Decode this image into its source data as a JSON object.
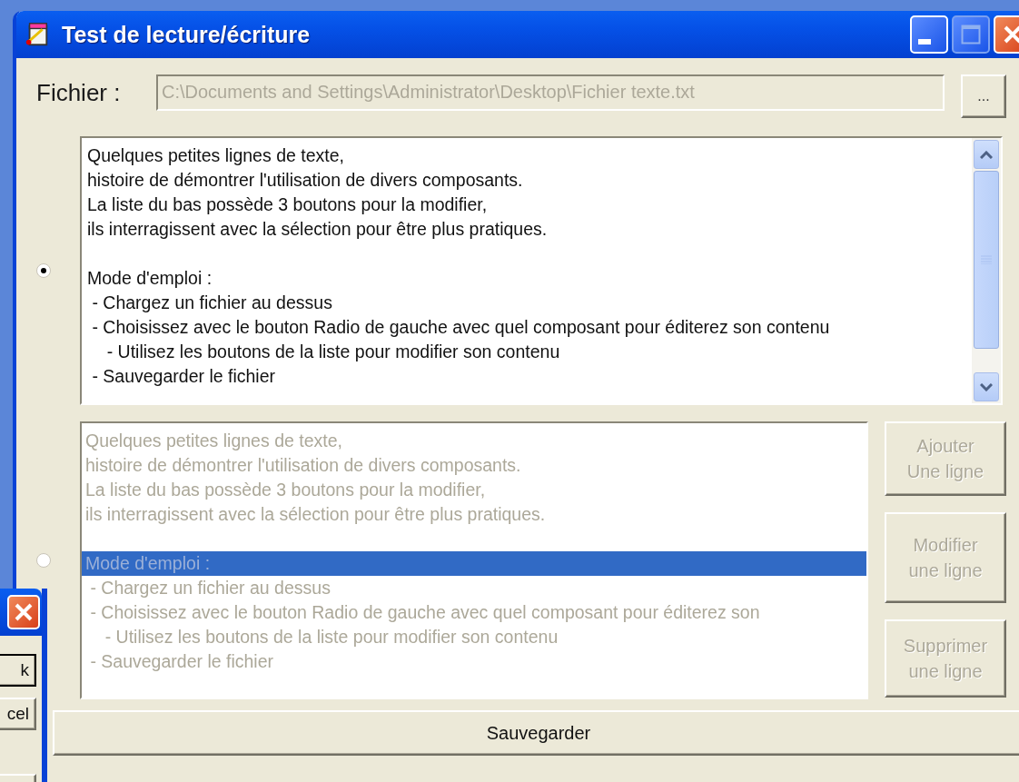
{
  "window": {
    "title": "Test de lecture/écriture"
  },
  "file": {
    "label": "Fichier :",
    "value": "C:\\Documents and Settings\\Administrator\\Desktop\\Fichier texte.txt",
    "disabled": true,
    "browse_button": "..."
  },
  "text_editor": {
    "selected": true,
    "text": "Quelques petites lignes de texte,\nhistoire de démontrer l'utilisation de divers composants.\nLa liste du bas possède 3 boutons pour la modifier,\nils interragissent avec la sélection pour être plus pratiques.\n\nMode d'emploi :\n - Chargez un fichier au dessus\n - Choisissez avec le bouton Radio de gauche avec quel composant pour éditerez son contenu\n    - Utilisez les boutons de la liste pour modifier son contenu\n - Sauvegarder le fichier"
  },
  "list_editor": {
    "selected": false,
    "items": [
      {
        "text": "Quelques petites lignes de texte,",
        "selected": false
      },
      {
        "text": "histoire de démontrer l'utilisation de divers composants.",
        "selected": false
      },
      {
        "text": "La liste du bas possède 3 boutons pour la modifier,",
        "selected": false
      },
      {
        "text": "ils interragissent avec la sélection pour être plus pratiques.",
        "selected": false
      },
      {
        "text": "Mode d'emploi :",
        "selected": true,
        "space_before": true
      },
      {
        "text": " - Chargez un fichier au dessus",
        "selected": false
      },
      {
        "text": " - Choisissez avec le bouton Radio de gauche avec quel composant pour éditerez son",
        "selected": false
      },
      {
        "text": "    - Utilisez les boutons de la liste pour modifier son contenu",
        "selected": false
      },
      {
        "text": " - Sauvegarder le fichier",
        "selected": false
      }
    ],
    "buttons": [
      {
        "label": "Ajouter\nUne ligne",
        "disabled": true
      },
      {
        "label": "Modifier\nune ligne",
        "disabled": true
      },
      {
        "label": "Supprimer\nune ligne",
        "disabled": true
      }
    ]
  },
  "save_button": "Sauvegarder",
  "back_dialog": {
    "buttons": [
      {
        "label": "k",
        "default": true
      },
      {
        "label": "cel",
        "default": false
      }
    ]
  }
}
